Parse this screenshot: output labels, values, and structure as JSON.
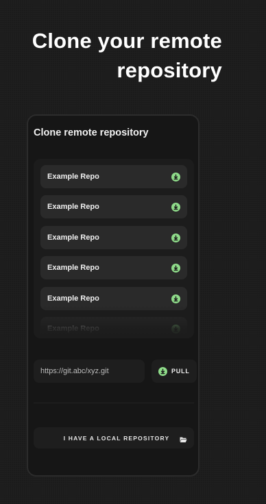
{
  "headline": {
    "line1": "Clone your remote",
    "line2": "repository"
  },
  "screen": {
    "title": "Clone remote repository",
    "repos": [
      {
        "name": "Example Repo",
        "icon": "download-icon"
      },
      {
        "name": "Example Repo",
        "icon": "download-icon"
      },
      {
        "name": "Example Repo",
        "icon": "download-icon"
      },
      {
        "name": "Example Repo",
        "icon": "download-icon"
      },
      {
        "name": "Example Repo",
        "icon": "download-icon"
      },
      {
        "name": "Example Repo",
        "icon": "download-icon"
      }
    ],
    "url_input": {
      "placeholder": "https://git.abc/xyz.git",
      "value": ""
    },
    "pull_button": {
      "label": "PULL",
      "icon": "download-icon"
    },
    "local_button": {
      "label": "I HAVE A LOCAL REPOSITORY",
      "icon": "folder-open-icon"
    }
  },
  "colors": {
    "background": "#1b1b1b",
    "phone_surface": "#161616",
    "card": "#2a2a2a",
    "accent_green": "#8fdc8a",
    "text": "#ffffff"
  }
}
